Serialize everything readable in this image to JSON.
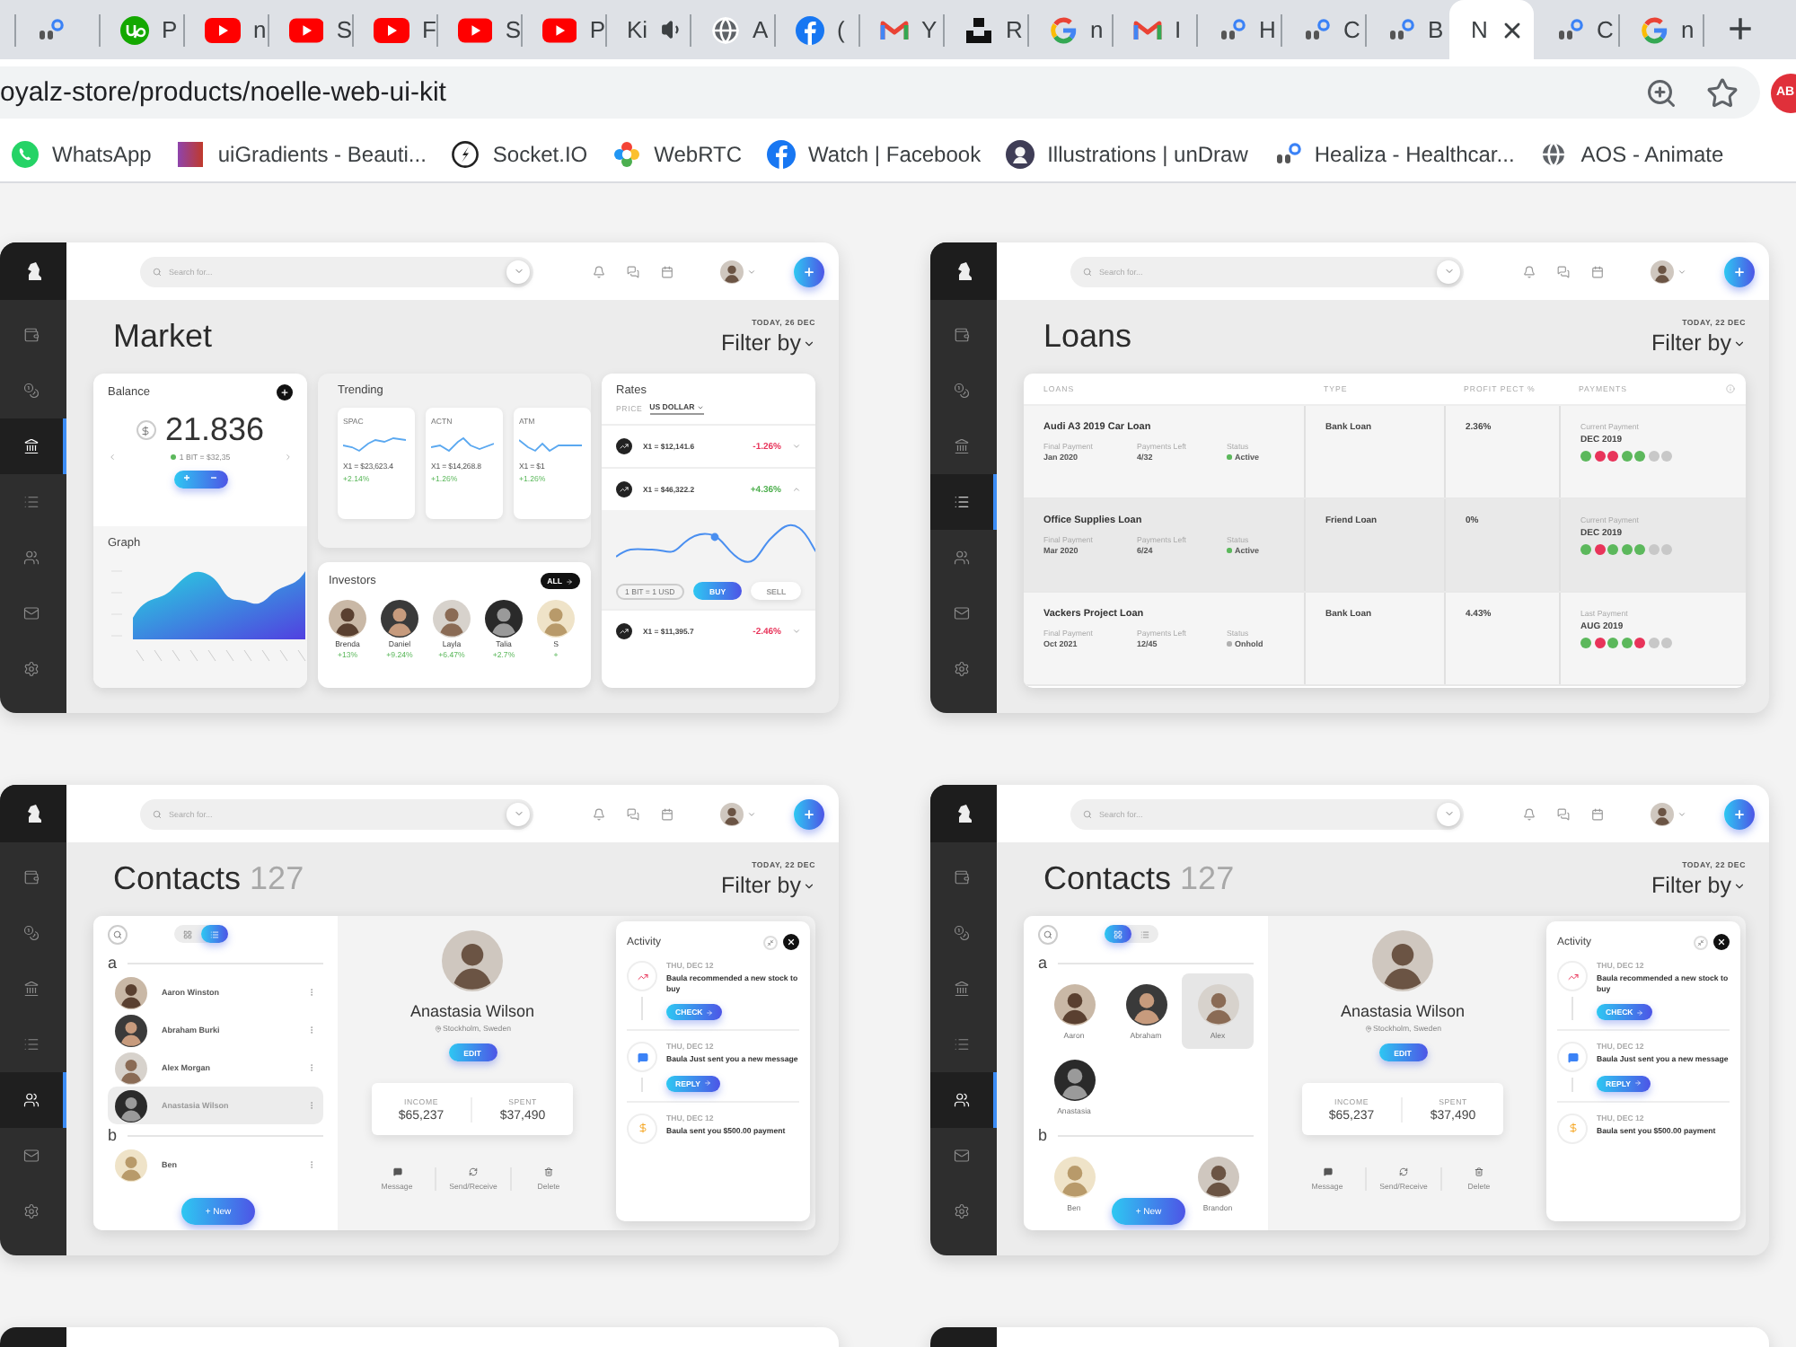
{
  "browser": {
    "tabs": [
      {
        "kind": "uiux",
        "selected": false
      },
      {
        "kind": "upwork",
        "title": "P",
        "selected": false
      },
      {
        "kind": "youtube",
        "title": "n",
        "selected": false
      },
      {
        "kind": "youtube",
        "title": "S",
        "selected": false
      },
      {
        "kind": "youtube",
        "title": "F",
        "selected": false
      },
      {
        "kind": "youtube",
        "title": "S",
        "selected": false
      },
      {
        "kind": "youtube",
        "title": "P",
        "selected": false
      },
      {
        "kind": "audio",
        "title": "Ki",
        "selected": false
      },
      {
        "kind": "globe",
        "title": "A",
        "selected": false
      },
      {
        "kind": "facebook",
        "title": "(",
        "selected": false
      },
      {
        "kind": "gmail",
        "title": "Y",
        "selected": false
      },
      {
        "kind": "unsplash",
        "title": "R",
        "selected": false
      },
      {
        "kind": "google",
        "title": "n",
        "selected": false
      },
      {
        "kind": "gmail",
        "title": "I",
        "selected": false
      },
      {
        "kind": "uiux",
        "title": "H",
        "selected": false
      },
      {
        "kind": "uiux",
        "title": "C",
        "selected": false
      },
      {
        "kind": "uiux",
        "title": "B",
        "selected": false
      },
      {
        "kind": "none",
        "title": "N",
        "selected": true
      },
      {
        "kind": "uiux",
        "title": "C",
        "selected": false
      },
      {
        "kind": "google",
        "title": "n",
        "selected": false
      }
    ],
    "new_tab": "+",
    "url": "oyalz-store/products/noelle-web-ui-kit",
    "extension": "AB",
    "bookmarks": [
      {
        "kind": "whatsapp",
        "label": "WhatsApp"
      },
      {
        "kind": "gradient",
        "label": "uiGradients - Beauti..."
      },
      {
        "kind": "socketio",
        "label": "Socket.IO"
      },
      {
        "kind": "webrtc",
        "label": "WebRTC"
      },
      {
        "kind": "facebook",
        "label": "Watch | Facebook"
      },
      {
        "kind": "undraw",
        "label": "Illustrations | unDraw"
      },
      {
        "kind": "uiux",
        "label": "Healiza - Healthcar..."
      },
      {
        "kind": "globe",
        "label": "AOS - Animate"
      }
    ]
  },
  "mockups": [
    {
      "kind": "market",
      "nav": [
        {
          "selected": false
        },
        {
          "selected": false
        },
        {
          "selected": true
        },
        {
          "selected": false
        },
        {
          "selected": false
        },
        {
          "selected": false
        },
        {
          "selected": false
        }
      ],
      "placeholder": "Search for...",
      "title": "Market",
      "date": "TODAY, 26 DEC",
      "filter": "Filter by",
      "balance": {
        "title": "Balance",
        "amount": "21.836",
        "rate": "1 BIT = $32,35",
        "plus": "+",
        "minus": "−"
      },
      "graph": {
        "title": "Graph"
      },
      "trending": {
        "title": "Trending",
        "items": [
          {
            "symbol": "SPAC",
            "value": "X1 = $23,623.4",
            "change": "+2.14%"
          },
          {
            "symbol": "ACTN",
            "value": "X1 = $14,268.8",
            "change": "+1.26%"
          },
          {
            "symbol": "ATM",
            "value": "X1 = $1",
            "change": "+1.26%"
          }
        ]
      },
      "investors": {
        "title": "Investors",
        "all": "ALL",
        "people": [
          {
            "name": "Brenda",
            "change": "+13%"
          },
          {
            "name": "Daniel",
            "change": "+9.24%"
          },
          {
            "name": "Layla",
            "change": "+6.47%"
          },
          {
            "name": "Talia",
            "change": "+2.7%"
          },
          {
            "name": "S",
            "change": "+"
          }
        ]
      },
      "rates": {
        "title": "Rates",
        "price_label": "PRICE",
        "currency": "US DOLLAR",
        "rows": [
          {
            "value": "X1 = $12,141.6",
            "change": "-1.26%",
            "color": "#e8345a",
            "expanded": false
          },
          {
            "value": "X1 = $46,322.2",
            "change": "+4.36%",
            "color": "#4cae4c",
            "expanded": true
          },
          {
            "value": "X1 = $11,395.7",
            "change": "-2.46%",
            "color": "#e8345a",
            "expanded": false
          }
        ],
        "conversion": "1 BIT = 1 USD",
        "buy": "BUY",
        "sell": "SELL"
      }
    },
    {
      "kind": "loans",
      "nav": [
        {
          "selected": false
        },
        {
          "selected": false
        },
        {
          "selected": false
        },
        {
          "selected": true
        },
        {
          "selected": false
        },
        {
          "selected": false
        },
        {
          "selected": false
        }
      ],
      "placeholder": "Search for...",
      "title": "Loans",
      "date": "TODAY, 22 DEC",
      "filter": "Filter by",
      "columns": [
        "LOANS",
        "TYPE",
        "PROFIT PECT %",
        "PAYMENTS"
      ],
      "rows": [
        {
          "selected": false,
          "name": "Audi A3 2019 Car Loan",
          "final_label": "Final Payment",
          "final": "Jan 2020",
          "left_label": "Payments Left",
          "left": "4/32",
          "status_label": "Status",
          "status": {
            "label": "Active",
            "color": "#5cb85c"
          },
          "type": "Bank Loan",
          "profit": "2.36%",
          "payment_label": "Current Payment",
          "payment_month": "DEC 2019",
          "payments": [
            {
              "color": "#5cb85c"
            },
            {
              "color": "#e8345a"
            },
            {
              "color": "#e8345a"
            },
            {
              "color": "#5cb85c"
            },
            {
              "color": "#5cb85c"
            },
            {
              "color": "#c8c8c8"
            },
            {
              "color": "#c8c8c8"
            }
          ]
        },
        {
          "selected": true,
          "name": "Office Supplies Loan",
          "final_label": "Final Payment",
          "final": "Mar 2020",
          "left_label": "Payments Left",
          "left": "6/24",
          "status_label": "Status",
          "status": {
            "label": "Active",
            "color": "#5cb85c"
          },
          "type": "Friend Loan",
          "profit": "0%",
          "payment_label": "Current Payment",
          "payment_month": "DEC 2019",
          "payments": [
            {
              "color": "#5cb85c"
            },
            {
              "color": "#e8345a"
            },
            {
              "color": "#5cb85c"
            },
            {
              "color": "#5cb85c"
            },
            {
              "color": "#5cb85c"
            },
            {
              "color": "#c8c8c8"
            },
            {
              "color": "#c8c8c8"
            }
          ]
        },
        {
          "selected": false,
          "name": "Vackers Project Loan",
          "final_label": "Final Payment",
          "final": "Oct 2021",
          "left_label": "Payments Left",
          "left": "12/45",
          "status_label": "Status",
          "status": {
            "label": "Onhold",
            "color": "#b0b0b0"
          },
          "type": "Bank Loan",
          "profit": "4.43%",
          "payment_label": "Last Payment",
          "payment_month": "AUG 2019",
          "payments": [
            {
              "color": "#5cb85c"
            },
            {
              "color": "#e8345a"
            },
            {
              "color": "#5cb85c"
            },
            {
              "color": "#5cb85c"
            },
            {
              "color": "#e8345a"
            },
            {
              "color": "#c8c8c8"
            },
            {
              "color": "#c8c8c8"
            }
          ]
        }
      ]
    },
    {
      "kind": "contacts",
      "nav": [
        {
          "selected": false
        },
        {
          "selected": false
        },
        {
          "selected": false
        },
        {
          "selected": false
        },
        {
          "selected": true
        },
        {
          "selected": false
        },
        {
          "selected": false
        }
      ],
      "placeholder": "Search for...",
      "title": "Contacts",
      "count": "127",
      "date": "TODAY, 22 DEC",
      "filter": "Filter by",
      "views": [
        {
          "kind": "grid",
          "selected": false
        },
        {
          "kind": "list",
          "selected": true
        }
      ],
      "groups": [
        {
          "letter": "a",
          "contacts": [
            {
              "name": "Aaron Winston",
              "selected": false
            },
            {
              "name": "Abraham Burki",
              "selected": false
            },
            {
              "name": "Alex Morgan",
              "selected": false
            },
            {
              "name": "Anastasia Wilson",
              "selected": true
            }
          ]
        },
        {
          "letter": "b",
          "contacts": [
            {
              "name": "Ben",
              "selected": false
            }
          ]
        }
      ],
      "new_button": "+ New",
      "profile": {
        "name": "Anastasia Wilson",
        "location": "Stockholm, Sweden",
        "edit": "EDIT",
        "income_label": "INCOME",
        "income": "$65,237",
        "spent_label": "SPENT",
        "spent": "$37,490",
        "actions": [
          {
            "kind": "message",
            "label": "Message"
          },
          {
            "kind": "transfer",
            "label": "Send/Receive"
          },
          {
            "kind": "delete",
            "label": "Delete"
          }
        ]
      },
      "activity": {
        "title": "Activity",
        "items": [
          {
            "kind": "stock",
            "date": "THU, DEC 12",
            "text": "Baula recommended a new stock to buy",
            "action": "CHECK"
          },
          {
            "kind": "message",
            "date": "THU, DEC 12",
            "text": "Baula Just sent you a new message",
            "action": "REPLY"
          },
          {
            "kind": "payment",
            "date": "THU, DEC 12",
            "text": "Baula sent you $500.00 payment"
          }
        ]
      }
    },
    {
      "kind": "contacts",
      "nav": [
        {
          "selected": false
        },
        {
          "selected": false
        },
        {
          "selected": false
        },
        {
          "selected": false
        },
        {
          "selected": true
        },
        {
          "selected": false
        },
        {
          "selected": false
        }
      ],
      "placeholder": "Search for...",
      "title": "Contacts",
      "count": "127",
      "date": "TODAY, 22 DEC",
      "filter": "Filter by",
      "views": [
        {
          "kind": "grid",
          "selected": true
        },
        {
          "kind": "list",
          "selected": false
        }
      ],
      "groups": [
        {
          "letter": "a",
          "contacts": [
            {
              "name": "Aaron",
              "selected": false
            },
            {
              "name": "Abraham",
              "selected": false
            },
            {
              "name": "Alex",
              "selected": true
            },
            {
              "name": "Anastasia",
              "selected": false
            }
          ]
        },
        {
          "letter": "b",
          "contacts": [
            {
              "name": "Ben",
              "selected": false
            },
            {
              "name": "Brandon",
              "selected": false
            }
          ]
        }
      ],
      "new_button": "+ New",
      "profile": {
        "name": "Anastasia Wilson",
        "location": "Stockholm, Sweden",
        "edit": "EDIT",
        "income_label": "INCOME",
        "income": "$65,237",
        "spent_label": "SPENT",
        "spent": "$37,490",
        "actions": [
          {
            "kind": "message",
            "label": "Message"
          },
          {
            "kind": "transfer",
            "label": "Send/Receive"
          },
          {
            "kind": "delete",
            "label": "Delete"
          }
        ]
      },
      "activity": {
        "title": "Activity",
        "items": [
          {
            "kind": "stock",
            "date": "THU, DEC 12",
            "text": "Baula recommended a new stock to buy",
            "action": "CHECK"
          },
          {
            "kind": "message",
            "date": "THU, DEC 12",
            "text": "Baula Just sent you a new message",
            "action": "REPLY"
          },
          {
            "kind": "payment",
            "date": "THU, DEC 12",
            "text": "Baula sent you $500.00 payment"
          }
        ]
      }
    },
    {
      "kind": "cropped"
    },
    {
      "kind": "cropped"
    }
  ]
}
